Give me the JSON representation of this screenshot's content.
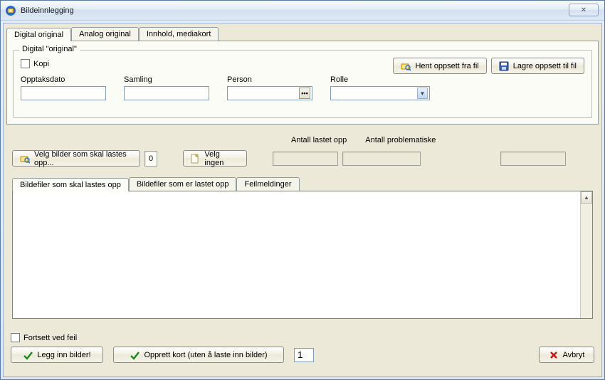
{
  "window": {
    "title": "Bildeinnlegging",
    "close_label": "✕"
  },
  "tabs_top": {
    "items": [
      {
        "label": "Digital original",
        "active": true
      },
      {
        "label": "Analog original",
        "active": false
      },
      {
        "label": "Innhold, mediakort",
        "active": false
      }
    ]
  },
  "group": {
    "legend": "Digital \"original\"",
    "kopi_label": "Kopi",
    "fields": {
      "opptaksdato": {
        "label": "Opptaksdato",
        "value": ""
      },
      "samling": {
        "label": "Samling",
        "value": ""
      },
      "person": {
        "label": "Person",
        "value": ""
      },
      "rolle": {
        "label": "Rolle",
        "value": ""
      }
    },
    "buttons": {
      "hent": "Hent oppsett fra fil",
      "lagre": "Lagre oppsett til fil"
    }
  },
  "mid": {
    "velg_bilder": "Velg bilder som skal lastes opp...",
    "count": "0",
    "velg_ingen": "Velg ingen",
    "antall_lastet_label": "Antall lastet opp",
    "antall_problem_label": "Antall problematiske",
    "antall_lastet_value": "",
    "antall_problem_value": "",
    "extra_value": ""
  },
  "tabs_files": {
    "items": [
      {
        "label": "Bildefiler som skal lastes opp",
        "active": true
      },
      {
        "label": "Bildefiler som er lastet opp",
        "active": false
      },
      {
        "label": "Feilmeldinger",
        "active": false
      }
    ]
  },
  "bottom": {
    "fortsett_label": "Fortsett ved feil",
    "legg_inn": "Legg inn bilder!",
    "opprett": "Opprett kort (uten å laste inn bilder)",
    "spin_value": "1",
    "avbryt": "Avbryt"
  }
}
